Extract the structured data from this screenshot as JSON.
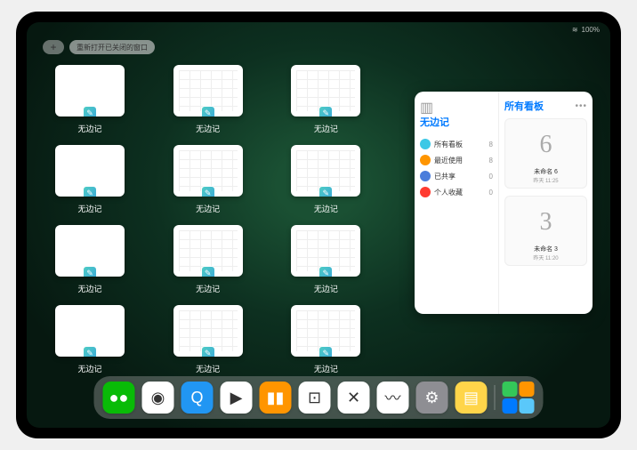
{
  "status": {
    "battery": "100%",
    "wifi": "●●●"
  },
  "topbar": {
    "plus": "+",
    "recent_label": "重新打开已关闭的窗口"
  },
  "app_name": "无边记",
  "windows": [
    {
      "label": "无边记",
      "style": "blank"
    },
    {
      "label": "无边记",
      "style": "grid"
    },
    {
      "label": "无边记",
      "style": "grid"
    },
    {
      "label": "无边记",
      "style": "blank"
    },
    {
      "label": "无边记",
      "style": "grid"
    },
    {
      "label": "无边记",
      "style": "grid"
    },
    {
      "label": "无边记",
      "style": "blank"
    },
    {
      "label": "无边记",
      "style": "grid"
    },
    {
      "label": "无边记",
      "style": "grid"
    },
    {
      "label": "无边记",
      "style": "blank"
    },
    {
      "label": "无边记",
      "style": "grid"
    },
    {
      "label": "无边记",
      "style": "grid"
    }
  ],
  "panel": {
    "left_title": "无边记",
    "items": [
      {
        "label": "所有看板",
        "count": 8,
        "color": "#3cc8e6"
      },
      {
        "label": "最近使用",
        "count": 8,
        "color": "#ff9500"
      },
      {
        "label": "已共享",
        "count": 0,
        "color": "#4a7ddb"
      },
      {
        "label": "个人收藏",
        "count": 0,
        "color": "#ff3b30"
      }
    ],
    "right_title": "所有看板",
    "boards": [
      {
        "glyph": "6",
        "name": "未命名 6",
        "date": "昨天 11:25"
      },
      {
        "glyph": "3",
        "name": "未命名 3",
        "date": "昨天 11:20"
      }
    ]
  },
  "dock": [
    {
      "name": "wechat",
      "bg": "#09bb07",
      "glyph": "●●"
    },
    {
      "name": "quark",
      "bg": "#fff",
      "glyph": "◉"
    },
    {
      "name": "browser-q",
      "bg": "#2196f3",
      "glyph": "Q"
    },
    {
      "name": "play",
      "bg": "#fff",
      "glyph": "▶"
    },
    {
      "name": "books",
      "bg": "#ff9500",
      "glyph": "▮▮"
    },
    {
      "name": "die",
      "bg": "#fff",
      "glyph": "⊡"
    },
    {
      "name": "dots",
      "bg": "#fff",
      "glyph": "✕"
    },
    {
      "name": "freeform",
      "bg": "#fff",
      "glyph": "〰"
    },
    {
      "name": "settings",
      "bg": "#8e8e93",
      "glyph": "⚙"
    },
    {
      "name": "notes",
      "bg": "#ffd54a",
      "glyph": "▤"
    }
  ]
}
